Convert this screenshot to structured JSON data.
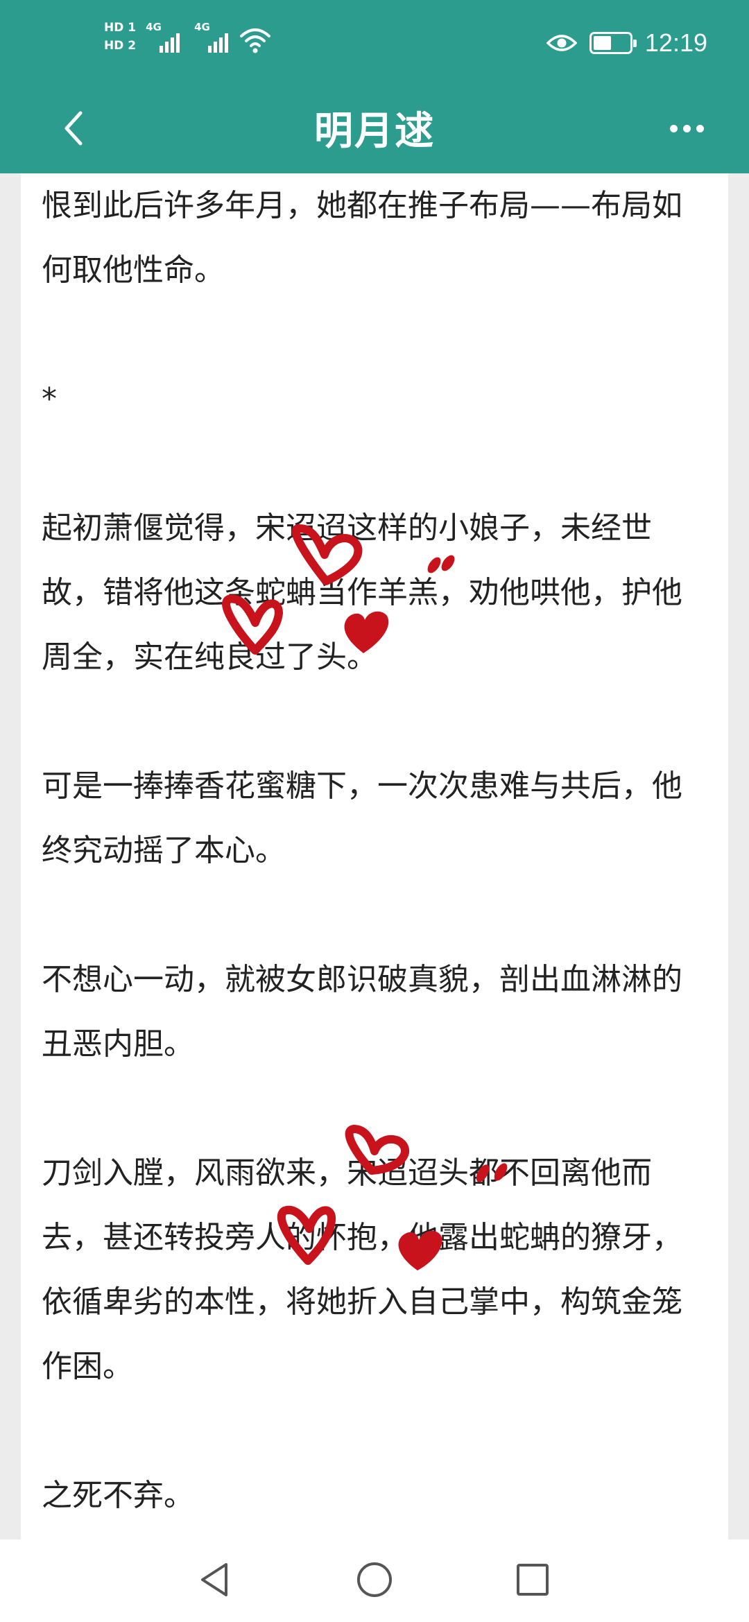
{
  "status_bar": {
    "sim1_badge": "HD 1",
    "sim2_badge": "HD 2",
    "sim1_network": "4G",
    "sim2_network": "4G",
    "time": "12:19",
    "battery_level": 0.45,
    "icons": [
      "signal-icon",
      "wifi-icon",
      "eye-icon",
      "battery-icon"
    ]
  },
  "header": {
    "title": "明月逑",
    "back_icon": "chevron-left-icon",
    "more_icon": "more-dots-icon"
  },
  "article": {
    "paragraphs": [
      [
        "恨到此后许多年月，她都在推子布局——布局如",
        "何取他性命。"
      ],
      [
        "*"
      ],
      [
        "起初萧偃觉得，宋迢迢这样的小娘子，未经世",
        "故，错将他这条蛇蚺当作羊羔，劝他哄他，护他",
        "周全，实在纯良过了头。"
      ],
      [
        "可是一捧捧香花蜜糖下，一次次患难与共后，他",
        "终究动摇了本心。"
      ],
      [
        "不想心一动，就被女郎识破真貌，剖出血淋淋的",
        "丑恶内胆。"
      ],
      [
        "刀剑入膛，风雨欲来，宋迢迢头都不回离他而",
        "去，甚还转投旁人的怀抱，他露出蛇蚺的獠牙，",
        "依循卑劣的本性，将她折入自己掌中，构筑金笼",
        "作困。"
      ],
      [
        "之死不弃。"
      ]
    ]
  },
  "decorations": {
    "heart_color": "#c8121c"
  },
  "bottom_nav": {
    "back_icon": "triangle-back-icon",
    "home_icon": "circle-home-icon",
    "recents_icon": "square-recents-icon"
  },
  "colors": {
    "header_bg": "#2b9c8e",
    "page_bg": "#ececec"
  }
}
